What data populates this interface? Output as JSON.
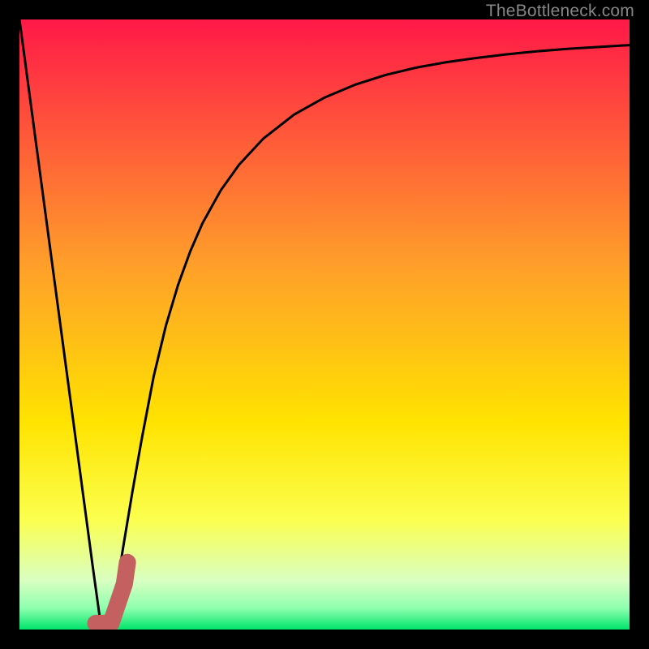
{
  "watermark": "TheBottleneck.com",
  "colors": {
    "gradient_top": "#ff1948",
    "gradient_mid": "#ffd500",
    "gradient_low": "#faff55",
    "gradient_pale": "#d9ffc2",
    "gradient_bottom": "#00e46b",
    "curve": "#000000",
    "marker_fill": "#c46060",
    "marker_stroke": "#c46060",
    "frame": "#000000"
  },
  "chart_data": {
    "type": "line",
    "title": "",
    "xlabel": "",
    "ylabel": "",
    "xlim": [
      0,
      1
    ],
    "ylim": [
      0,
      1
    ],
    "series": [
      {
        "name": "bottleneck-curve",
        "x": [
          0.0,
          0.015,
          0.03,
          0.045,
          0.06,
          0.075,
          0.09,
          0.105,
          0.12,
          0.133,
          0.145,
          0.158,
          0.17,
          0.185,
          0.2,
          0.22,
          0.24,
          0.26,
          0.28,
          0.3,
          0.33,
          0.36,
          0.4,
          0.45,
          0.5,
          0.55,
          0.6,
          0.65,
          0.7,
          0.75,
          0.8,
          0.85,
          0.9,
          0.95,
          1.0
        ],
        "values": [
          1.0,
          0.888,
          0.776,
          0.664,
          0.552,
          0.44,
          0.328,
          0.216,
          0.104,
          0.01,
          0.01,
          0.06,
          0.135,
          0.225,
          0.31,
          0.415,
          0.498,
          0.565,
          0.62,
          0.666,
          0.72,
          0.762,
          0.805,
          0.844,
          0.872,
          0.893,
          0.909,
          0.921,
          0.93,
          0.937,
          0.943,
          0.948,
          0.952,
          0.955,
          0.958
        ]
      }
    ],
    "marker": {
      "name": "optimal-point-j",
      "points": [
        {
          "x": 0.125,
          "y": 0.01
        },
        {
          "x": 0.15,
          "y": 0.01
        },
        {
          "x": 0.172,
          "y": 0.075
        },
        {
          "x": 0.177,
          "y": 0.11
        }
      ],
      "width": 0.028
    },
    "gradient_stops": [
      {
        "offset": 0.0,
        "color": "#ff1948"
      },
      {
        "offset": 0.4,
        "color": "#ff9e2a"
      },
      {
        "offset": 0.66,
        "color": "#ffe300"
      },
      {
        "offset": 0.82,
        "color": "#fbff4e"
      },
      {
        "offset": 0.92,
        "color": "#d9ffc2"
      },
      {
        "offset": 0.965,
        "color": "#8effae"
      },
      {
        "offset": 1.0,
        "color": "#00e46b"
      }
    ]
  }
}
